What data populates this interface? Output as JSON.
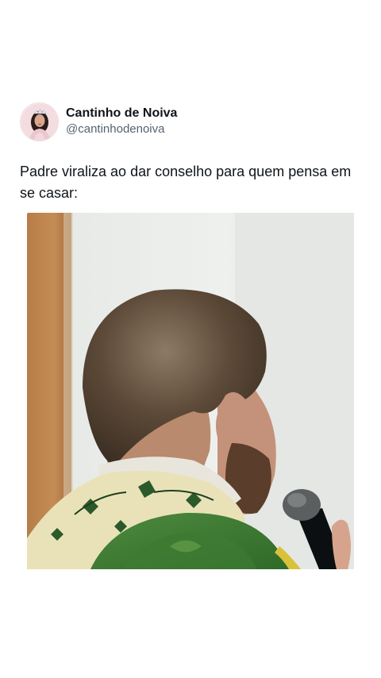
{
  "post": {
    "display_name": "Cantinho de Noiva",
    "handle": "@cantinhodenoiva",
    "text": "Padre viraliza ao dar conselho para quem pensa em se casar:",
    "avatar_icon": "bride-with-tiara-avatar",
    "media_icon": "video-frame-priest-with-microphone"
  },
  "colors": {
    "text": "#0f1419",
    "secondary_text": "#536471",
    "background": "#ffffff"
  }
}
